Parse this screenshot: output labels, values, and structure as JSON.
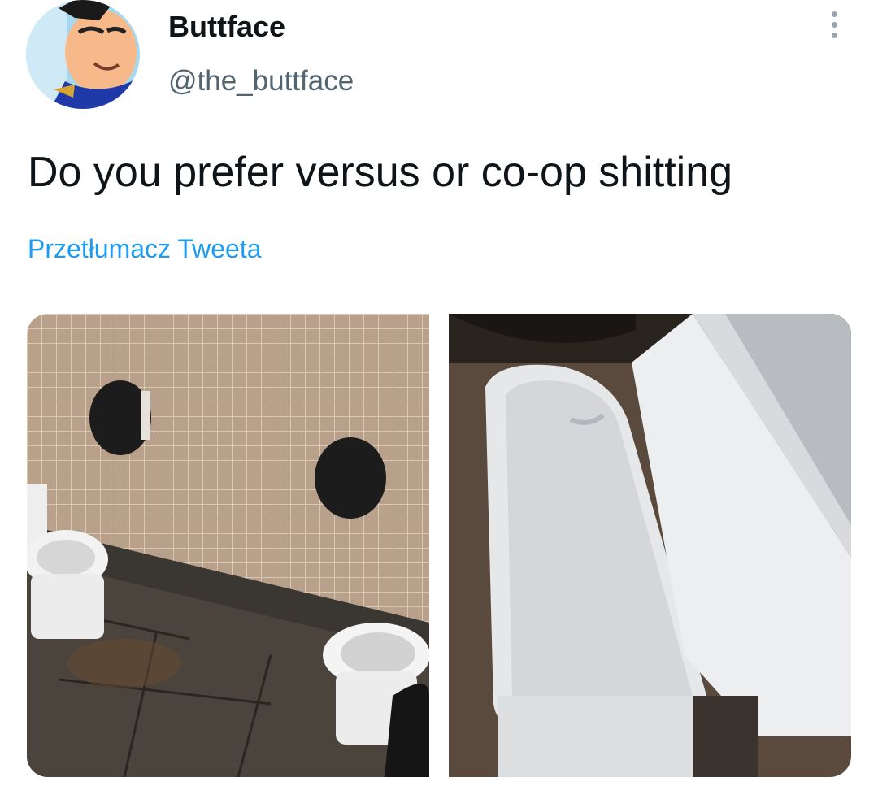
{
  "tweet": {
    "display_name": "Buttface",
    "handle": "@the_buttface",
    "text": "Do you prefer versus or co-op shitting",
    "translate_label": "Przetłumacz Tweeta"
  },
  "icons": {
    "more": "more-vertical-icon",
    "avatar": "cartoon-character-avatar"
  },
  "colors": {
    "text": "#0f1419",
    "secondary": "#536471",
    "link": "#1d9bf0"
  }
}
